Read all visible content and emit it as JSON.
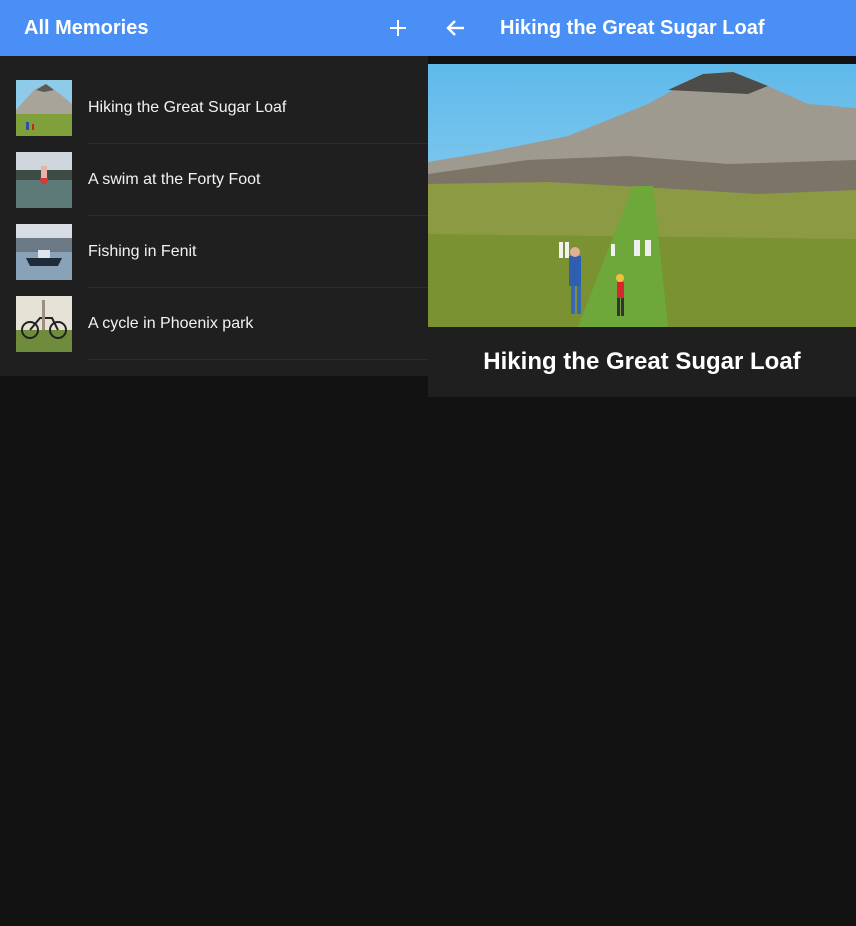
{
  "list_pane": {
    "title": "All Memories",
    "add_icon": "plus-icon",
    "memories": [
      {
        "label": "Hiking the Great Sugar Loaf",
        "thumb": "mountain-hike"
      },
      {
        "label": "A swim at the Forty Foot",
        "thumb": "sea-swim"
      },
      {
        "label": "Fishing in Fenit",
        "thumb": "harbour-boat"
      },
      {
        "label": "A cycle in Phoenix park",
        "thumb": "bicycle"
      }
    ]
  },
  "detail_pane": {
    "title": "Hiking the Great Sugar Loaf",
    "back_icon": "arrow-left-icon",
    "caption": "Hiking the Great Sugar Loaf"
  },
  "colors": {
    "app_bar": "#4a8ff5",
    "background": "#121212",
    "surface": "#1f1f1f"
  }
}
